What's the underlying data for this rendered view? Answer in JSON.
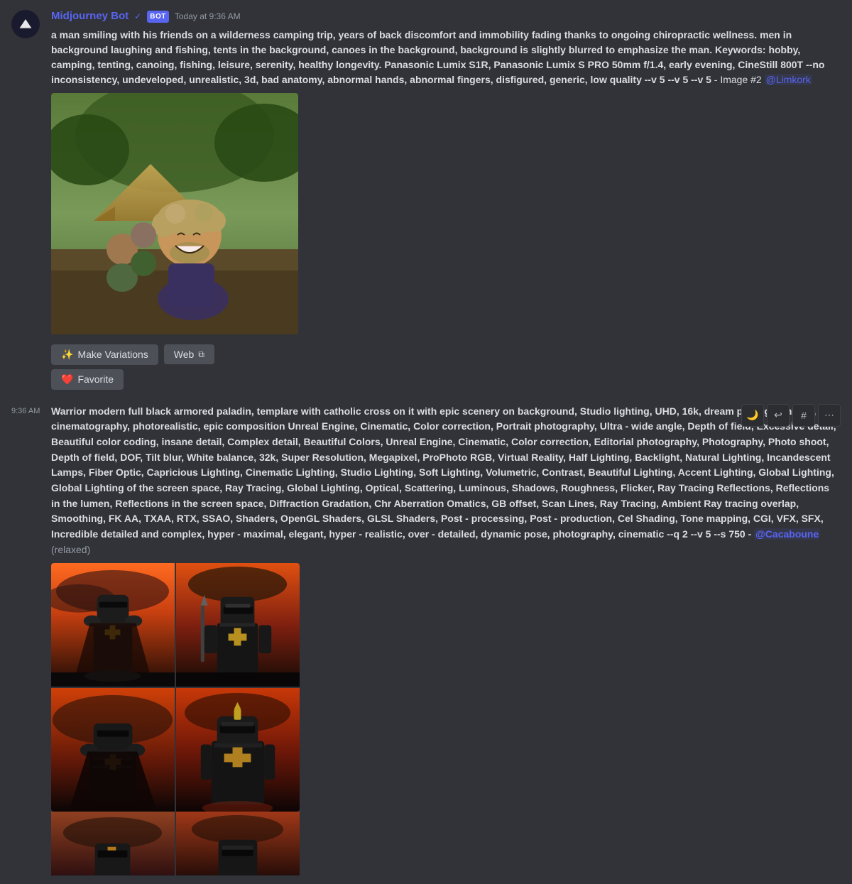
{
  "messages": [
    {
      "id": "msg1",
      "bot_name": "Midjourney Bot",
      "bot_badge": "BOT",
      "timestamp": "Today at 9:36 AM",
      "prompt": "a man smiling with his friends on a wilderness camping trip, years of back discomfort and immobility fading thanks to ongoing chiropractic wellness. men in background laughing and fishing, tents in the background, canoes in the background, background is slightly blurred to emphasize the man. Keywords: hobby, camping, tenting, canoing, fishing, leisure, serenity, healthy longevity. Panasonic Lumix S1R, Panasonic Lumix S PRO 50mm f/1.4, early evening, CineStill 800T --no inconsistency, undeveloped, unrealistic, 3d, bad anatomy, abnormal hands, abnormal fingers, disfigured, generic, low quality --v 5 --v 5 --v 5",
      "suffix": "- Image #2",
      "mention": "@Limkork",
      "buttons": [
        {
          "id": "make-variations",
          "label": "Make Variations",
          "icon": "✨"
        },
        {
          "id": "web",
          "label": "Web",
          "icon": "🔗"
        }
      ],
      "favorite_label": "Favorite",
      "favorite_icon": "❤️"
    },
    {
      "id": "msg2",
      "timestamp": "9:36 AM",
      "prompt": "Warrior modern full black armored paladin, templare with catholic cross on it with epic scenery on background, Studio lighting, UHD, 16k, dream photography, 8k, cinematography, photorealistic, epic composition Unreal Engine, Cinematic, Color correction, Portrait photography, Ultra - wide angle, Depth of field, Excessive detail, Beautiful color coding, insane detail, Complex detail, Beautiful Colors, Unreal Engine, Cinematic, Color correction, Editorial photography, Photography, Photo shoot, Depth of field, DOF, Tilt blur, White balance, 32k, Super Resolution, Megapixel, ProPhoto RGB, Virtual Reality, Half Lighting, Backlight, Natural Lighting, Incandescent Lamps, Fiber Optic, Capricious Lighting, Cinematic Lighting, Studio Lighting, Soft Lighting, Volumetric, Contrast, Beautiful Lighting, Accent Lighting, Global Lighting, Global Lighting of the screen space, Ray Tracing, Global Lighting, Optical, Scattering, Luminous, Shadows, Roughness, Flicker, Ray Tracing Reflections, Reflections in the lumen, Reflections in the screen space, Diffraction Gradation, Chr Aberration Omatics, GB offset, Scan Lines, Ray Tracing, Ambient Ray tracing overlap, Smoothing, FK AA, TXAA, RTX, SSAO, Shaders, OpenGL Shaders, GLSL Shaders, Post - processing, Post - production, Cel Shading, Tone mapping, CGI, VFX, SFX, Incredible detailed and complex, hyper - maximal, elegant, hyper - realistic, over - detailed, dynamic pose, photography, cinematic --q 2 --v 5 --s 750 -",
      "mention": "@Cacaboune",
      "relaxed": "(relaxed)",
      "action_icons": [
        "🌙",
        "↩",
        "#",
        "⋯"
      ]
    }
  ],
  "icons": {
    "sparkles": "✨",
    "external_link": "⧉",
    "heart": "❤️",
    "moon": "🌙",
    "reply": "↩",
    "hash": "#",
    "more": "⋯"
  }
}
